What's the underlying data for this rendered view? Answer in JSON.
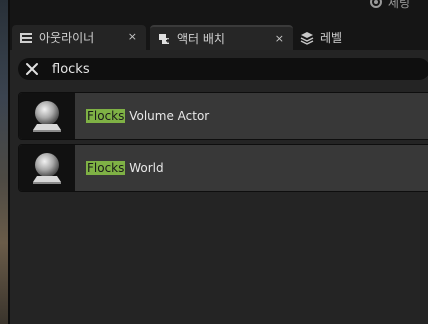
{
  "settings": {
    "label": "세팅"
  },
  "tabs": [
    {
      "label": "아웃라이너",
      "icon": "outliner-icon",
      "close": "×",
      "state": "inactive"
    },
    {
      "label": "액터 배치",
      "icon": "place-actors-icon",
      "close": "×",
      "state": "active"
    },
    {
      "label": "레벨",
      "icon": "levels-icon",
      "state": "plain"
    }
  ],
  "search": {
    "value": "flocks",
    "placeholder": ""
  },
  "results": [
    {
      "match": "Flocks",
      "rest": " Volume Actor",
      "icon": "sphere-actor-icon"
    },
    {
      "match": "Flocks",
      "rest": " World",
      "icon": "sphere-actor-icon"
    }
  ],
  "colors": {
    "highlight": "#7fb145",
    "panel": "#242424",
    "item": "#383838"
  }
}
